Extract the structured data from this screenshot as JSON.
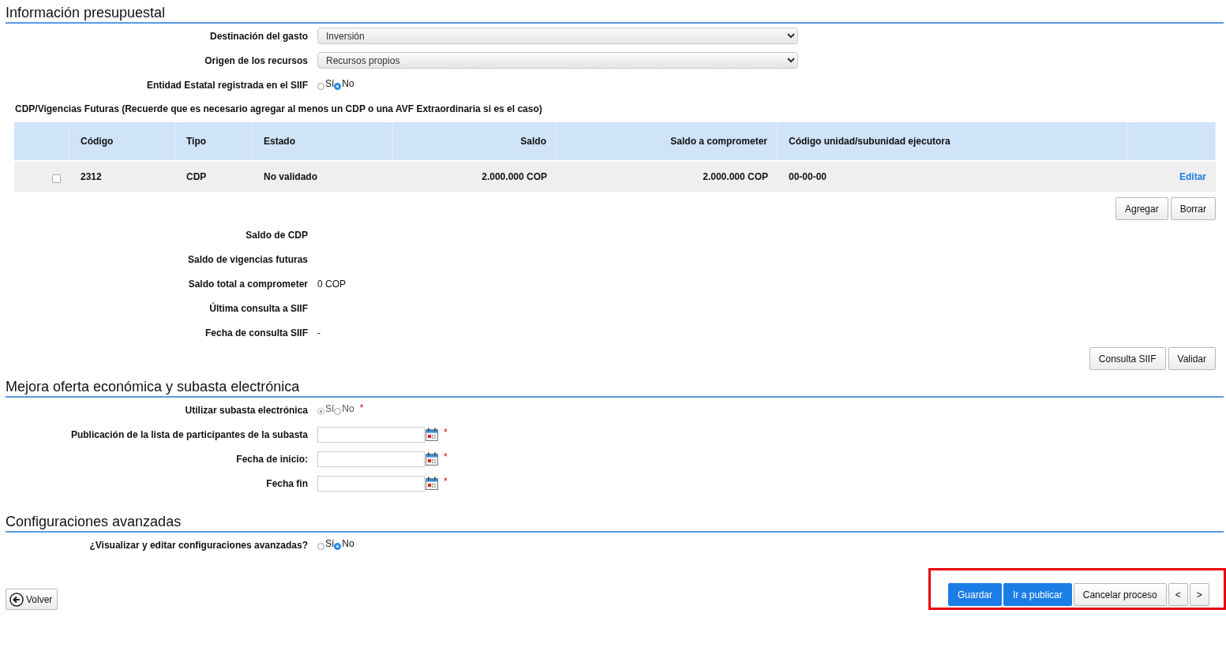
{
  "budget": {
    "title": "Información presupuestal",
    "fields": [
      {
        "kind": "select",
        "label": "Destinación del gasto",
        "value": "Inversión"
      },
      {
        "kind": "select",
        "label": "Origen de los recursos",
        "value": "Recursos propios"
      },
      {
        "kind": "radio",
        "label": "Entidad Estatal registrada en el SIIF",
        "disabled": false,
        "options": [
          {
            "label": "Sí",
            "selected": false
          },
          {
            "label": "No",
            "selected": true
          }
        ]
      }
    ],
    "table_caption": "CDP/Vigencias Futuras (Recuerde que es necesario agregar al menos un CDP o una AVF Extraordinaria si es el caso)",
    "table": {
      "columns": [
        "Código",
        "Tipo",
        "Estado",
        "Saldo",
        "Saldo a comprometer",
        "Código unidad/subunidad ejecutora"
      ],
      "rows": [
        {
          "checked": false,
          "cells": [
            "2312",
            "CDP",
            "No validado",
            "2.000.000 COP",
            "2.000.000 COP",
            "00-00-00"
          ],
          "action": "Editar"
        }
      ]
    },
    "table_buttons": [
      "Agregar",
      "Borrar"
    ],
    "summary": [
      {
        "label": "Saldo de CDP"
      },
      {
        "label": "Saldo de vigencias futuras"
      },
      {
        "label": "Saldo total a comprometer",
        "value": "0 COP"
      },
      {
        "label": "Última consulta a SIIF"
      },
      {
        "label": "Fecha de consulta SIIF",
        "value": "-"
      }
    ],
    "buttons": [
      "Consulta SIIF",
      "Validar"
    ]
  },
  "auction": {
    "title": "Mejora oferta económica y subasta electrónica",
    "fields": [
      {
        "kind": "radio",
        "label": "Utilizar subasta electrónica",
        "disabled": true,
        "required_mark": "*",
        "options": [
          {
            "label": "Sí",
            "selected": true
          },
          {
            "label": "No",
            "selected": false
          }
        ]
      },
      {
        "kind": "date",
        "label": "Publicación de la lista de participantes de la subasta",
        "required_mark": "*"
      },
      {
        "kind": "date",
        "label": "Fecha de inicio:",
        "required_mark": "*"
      },
      {
        "kind": "date",
        "label": "Fecha fin",
        "required_mark": "*"
      }
    ]
  },
  "advanced": {
    "title": "Configuraciones avanzadas",
    "fields": [
      {
        "kind": "radio",
        "label": "¿Visualizar y editar configuraciones avanzadas?",
        "disabled": false,
        "options": [
          {
            "label": "Sí",
            "selected": false
          },
          {
            "label": "No",
            "selected": true
          }
        ]
      }
    ]
  },
  "footer": {
    "back": "Volver",
    "actions": [
      {
        "label": "Guardar",
        "primary": true
      },
      {
        "label": "Ir a publicar",
        "primary": true
      },
      {
        "label": "Cancelar proceso",
        "primary": false
      },
      {
        "label": "<",
        "primary": false
      },
      {
        "label": ">",
        "primary": false
      }
    ]
  }
}
